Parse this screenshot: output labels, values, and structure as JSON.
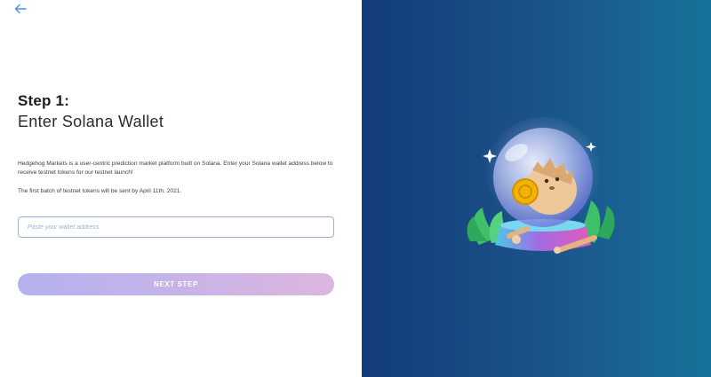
{
  "nav": {
    "back_icon": "arrow-left-icon"
  },
  "heading": {
    "step": "Step 1:",
    "subtitle": "Enter Solana Wallet"
  },
  "body": {
    "description": "Hedgehog Markets is a user-centric prediction market platform built on Solana. Enter your Solana wallet address below to receive testnet tokens for our testnet launch!",
    "note": "The first batch of testnet tokens will be sent by April 11th, 2021."
  },
  "wallet": {
    "placeholder": "Paste your wallet address",
    "value": ""
  },
  "actions": {
    "next_label": "NEXT STEP"
  },
  "colors": {
    "accent": "#4a90e2",
    "panel_gradient_start": "#123c7a",
    "panel_gradient_end": "#17729a",
    "button_gradient_start": "#b4b2ee",
    "button_gradient_end": "#ddb6df"
  },
  "illustration": {
    "icon": "hedgehog-crystal-ball-illustration"
  }
}
